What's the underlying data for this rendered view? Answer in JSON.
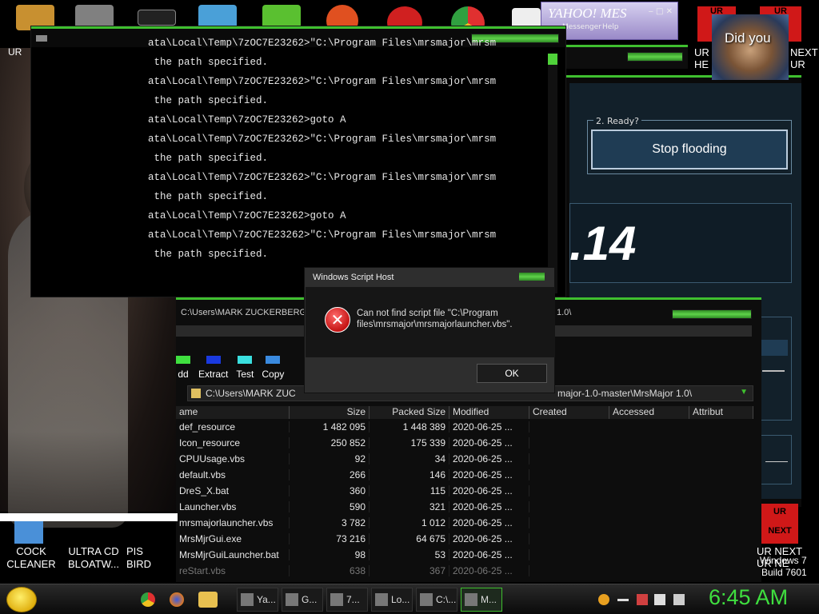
{
  "console": {
    "lines": [
      "ata\\Local\\Temp\\7zOC7E23262>\"C:\\Program Files\\mrsmajor\\mrsm",
      " the path specified.",
      "ata\\Local\\Temp\\7zOC7E23262>\"C:\\Program Files\\mrsmajor\\mrsm",
      " the path specified.",
      "ata\\Local\\Temp\\7zOC7E23262>goto A",
      "ata\\Local\\Temp\\7zOC7E23262>\"C:\\Program Files\\mrsmajor\\mrsm",
      " the path specified.",
      "ata\\Local\\Temp\\7zOC7E23262>\"C:\\Program Files\\mrsmajor\\mrsm",
      " the path specified.",
      "ata\\Local\\Temp\\7zOC7E23262>goto A",
      "ata\\Local\\Temp\\7zOC7E23262>\"C:\\Program Files\\mrsmajor\\mrsm",
      " the path specified."
    ]
  },
  "ready_panel": {
    "group_label": "2. Ready?",
    "stop_button": "Stop flooding",
    "counter": ".14"
  },
  "yahoo": {
    "logo": "YAHOO! MES",
    "sub1": "Messenger",
    "sub2": "Help"
  },
  "obama": {
    "caption": "Did you"
  },
  "ur_labels": {
    "top_left": "UR",
    "top_right": "UR",
    "side_left": "UR",
    "side_left2": "HE",
    "side_right": "NEXT",
    "side_right2": "UR",
    "bottom_top": "UR",
    "bottom_bottom": "NEXT",
    "bottom_caption1": "UR NEXT",
    "bottom_caption2": "UR NE",
    "top_left_icon": "UR"
  },
  "file_manager": {
    "title": "C:\\Users\\MARK ZUCKERBERG\\D",
    "title_right": "1.0\\",
    "toolbar": [
      {
        "label": "dd",
        "color": "#3fdf3f"
      },
      {
        "label": "Extract",
        "color": "#1a3adf"
      },
      {
        "label": "Test",
        "color": "#3adfdf"
      },
      {
        "label": "Copy",
        "color": "#3a8adf"
      }
    ],
    "address_left": "C:\\Users\\MARK ZUC",
    "address_right": "major-1.0-master\\MrsMajor 1.0\\",
    "columns": [
      "ame",
      "Size",
      "Packed Size",
      "Modified",
      "Created",
      "Accessed",
      "Attribut"
    ],
    "rows": [
      {
        "name": "def_resource",
        "size": "1 482 095",
        "packed": "1 448 389",
        "modified": "2020-06-25 ..."
      },
      {
        "name": "Icon_resource",
        "size": "250 852",
        "packed": "175 339",
        "modified": "2020-06-25 ..."
      },
      {
        "name": "CPUUsage.vbs",
        "size": "92",
        "packed": "34",
        "modified": "2020-06-25 ..."
      },
      {
        "name": "default.vbs",
        "size": "266",
        "packed": "146",
        "modified": "2020-06-25 ..."
      },
      {
        "name": "DreS_X.bat",
        "size": "360",
        "packed": "115",
        "modified": "2020-06-25 ..."
      },
      {
        "name": "Launcher.vbs",
        "size": "590",
        "packed": "321",
        "modified": "2020-06-25 ..."
      },
      {
        "name": "mrsmajorlauncher.vbs",
        "size": "3 782",
        "packed": "1 012",
        "modified": "2020-06-25 ..."
      },
      {
        "name": "MrsMjrGui.exe",
        "size": "73 216",
        "packed": "64 675",
        "modified": "2020-06-25 ..."
      },
      {
        "name": "MrsMjrGuiLauncher.bat",
        "size": "98",
        "packed": "53",
        "modified": "2020-06-25 ..."
      },
      {
        "name": "reStart.vbs",
        "size": "638",
        "packed": "367",
        "modified": "2020-06-25 ..."
      }
    ]
  },
  "dialog": {
    "title": "Windows Script Host",
    "message": "Can not find script file \"C:\\Program files\\mrsmajor\\mrsmajorlauncher.vbs\".",
    "ok": "OK"
  },
  "desktop_icons": [
    {
      "line1": "COCK",
      "line2": "CLEANER"
    },
    {
      "line1": "ULTRA CD",
      "line2": "BLOATW..."
    },
    {
      "line1": "PIS",
      "line2": "BIRD"
    }
  ],
  "watermark": {
    "line1": "Windows 7",
    "line2": "Build 7601"
  },
  "taskbar": {
    "tasks": [
      "Ya...",
      "G...",
      "7...",
      "Lo...",
      "C:\\...",
      "M..."
    ],
    "clock": "6:45 AM"
  },
  "colors": {
    "accent_green": "#3fbf2f",
    "clock_green": "#3fdf3f",
    "error_red": "#c41414"
  }
}
